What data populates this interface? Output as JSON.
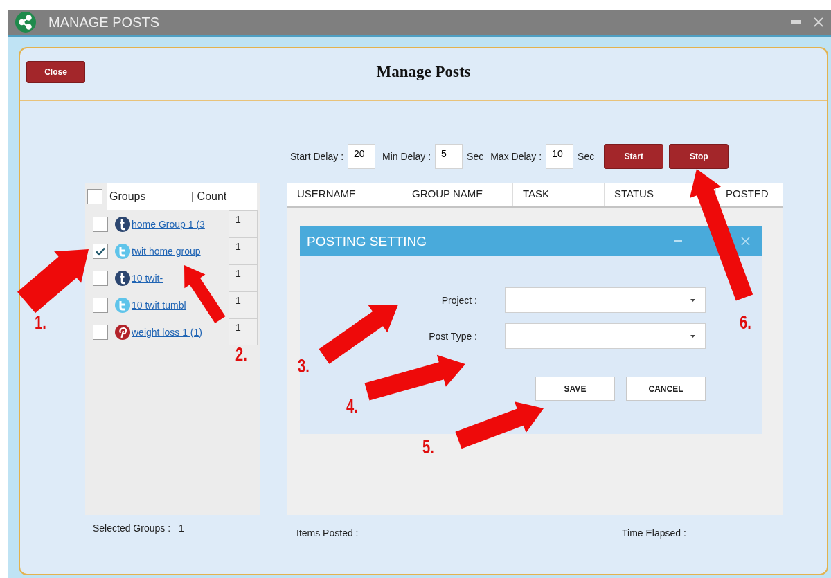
{
  "window": {
    "title": "MANAGE POSTS"
  },
  "header": {
    "close_button": "Close",
    "title": "Manage Posts"
  },
  "delays": [
    {
      "label": "Start Delay :",
      "value": "20"
    },
    {
      "label": "Min Delay :",
      "value": "5",
      "unit": "Sec"
    },
    {
      "label": "Max Delay :",
      "value": "10",
      "unit": "Sec"
    }
  ],
  "actions": [
    "Start",
    "Stop"
  ],
  "groups": {
    "all_checked": false,
    "columns": [
      "Groups",
      "| Count"
    ],
    "items": [
      {
        "kind": "tumblr",
        "name": "home Group 1 (3",
        "count": "1",
        "checked": false
      },
      {
        "kind": "twitter",
        "name": "twit home group",
        "count": "1",
        "checked": true
      },
      {
        "kind": "tumblr",
        "name": "10 twit-",
        "count": "1",
        "checked": false
      },
      {
        "kind": "twitter",
        "name": "10 twit tumbl",
        "count": "1",
        "checked": false
      },
      {
        "kind": "pinterest",
        "name": "weight loss 1 (1)",
        "count": "1",
        "checked": false
      }
    ]
  },
  "selected_groups": {
    "label": "Selected Groups :",
    "value": "1"
  },
  "table": {
    "columns": [
      "USERNAME",
      "GROUP NAME",
      "TASK",
      "STATUS",
      "POSTED"
    ]
  },
  "dialog": {
    "title": "POSTING SETTING",
    "fields": [
      {
        "label": "Project :"
      },
      {
        "label": "Post Type :"
      }
    ],
    "buttons": [
      "SAVE",
      "CANCEL"
    ]
  },
  "footer": {
    "items_posted": "Items Posted :",
    "time_elapsed": "Time Elapsed :"
  },
  "annotations": [
    {
      "label": "1."
    },
    {
      "label": "2."
    },
    {
      "label": "3."
    },
    {
      "label": "4."
    },
    {
      "label": "5."
    },
    {
      "label": "6."
    }
  ]
}
